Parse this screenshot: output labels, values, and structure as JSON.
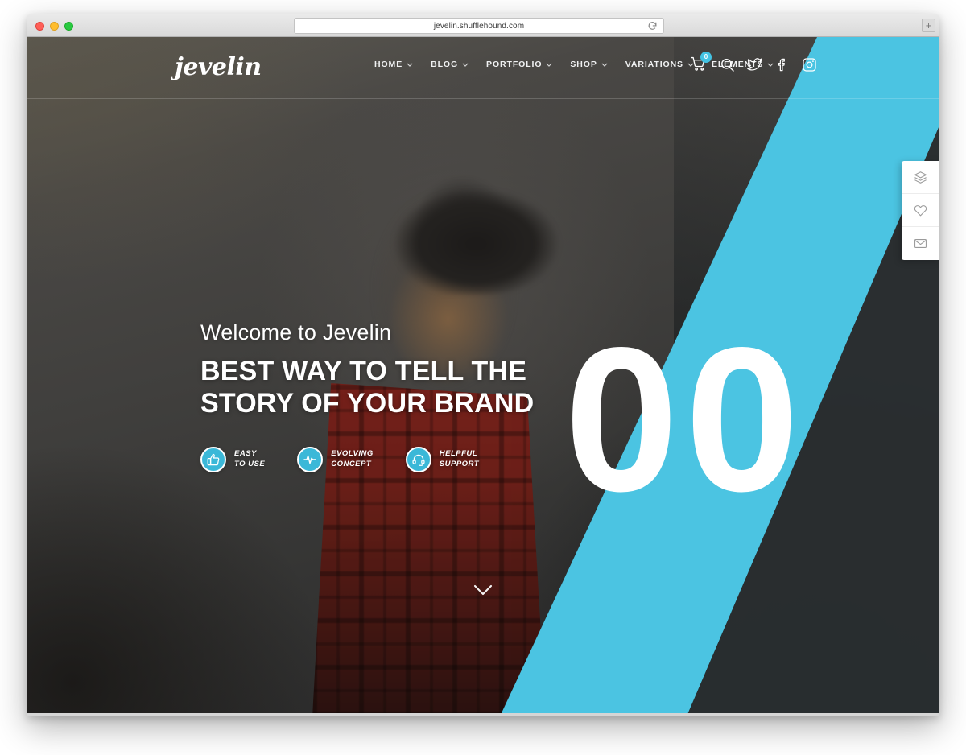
{
  "browser": {
    "url": "jevelin.shufflehound.com",
    "traffic_lights": [
      "close",
      "minimize",
      "maximize"
    ],
    "reload_icon": "reload-icon",
    "new_tab_label": "+"
  },
  "site": {
    "logo": "jevelin",
    "nav": [
      {
        "label": "HOME",
        "has_dropdown": true
      },
      {
        "label": "BLOG",
        "has_dropdown": true
      },
      {
        "label": "PORTFOLIO",
        "has_dropdown": true
      },
      {
        "label": "SHOP",
        "has_dropdown": true
      },
      {
        "label": "VARIATIONS",
        "has_dropdown": true
      },
      {
        "label": "ELEMENTS",
        "has_dropdown": true
      }
    ],
    "tools": {
      "cart_icon": "shopping-cart-icon",
      "cart_count": "0",
      "search_icon": "search-icon",
      "twitter_icon": "twitter-icon",
      "facebook_icon": "facebook-icon",
      "instagram_icon": "instagram-icon"
    }
  },
  "hero": {
    "eyebrow": "Welcome to Jevelin",
    "title_line1": "BEST WAY TO TELL THE",
    "title_line2": "STORY OF YOUR BRAND",
    "big_number": "00",
    "scroll_icon": "chevron-down-icon",
    "features": [
      {
        "icon": "thumbs-up-icon",
        "line1": "EASY",
        "line2": "TO USE"
      },
      {
        "icon": "activity-pulse-icon",
        "line1": "EVOLVING",
        "line2": "CONCEPT"
      },
      {
        "icon": "headset-icon",
        "line1": "HELPFUL",
        "line2": "SUPPORT"
      }
    ]
  },
  "side_panel": [
    {
      "icon": "layers-icon"
    },
    {
      "icon": "heart-icon"
    },
    {
      "icon": "envelope-icon"
    }
  ],
  "colors": {
    "accent_cyan": "#43c3e3",
    "band_cyan": "#4bc4e2",
    "text_white": "#ffffff",
    "header_bg": "rgba(40,46,50,0.92)"
  }
}
